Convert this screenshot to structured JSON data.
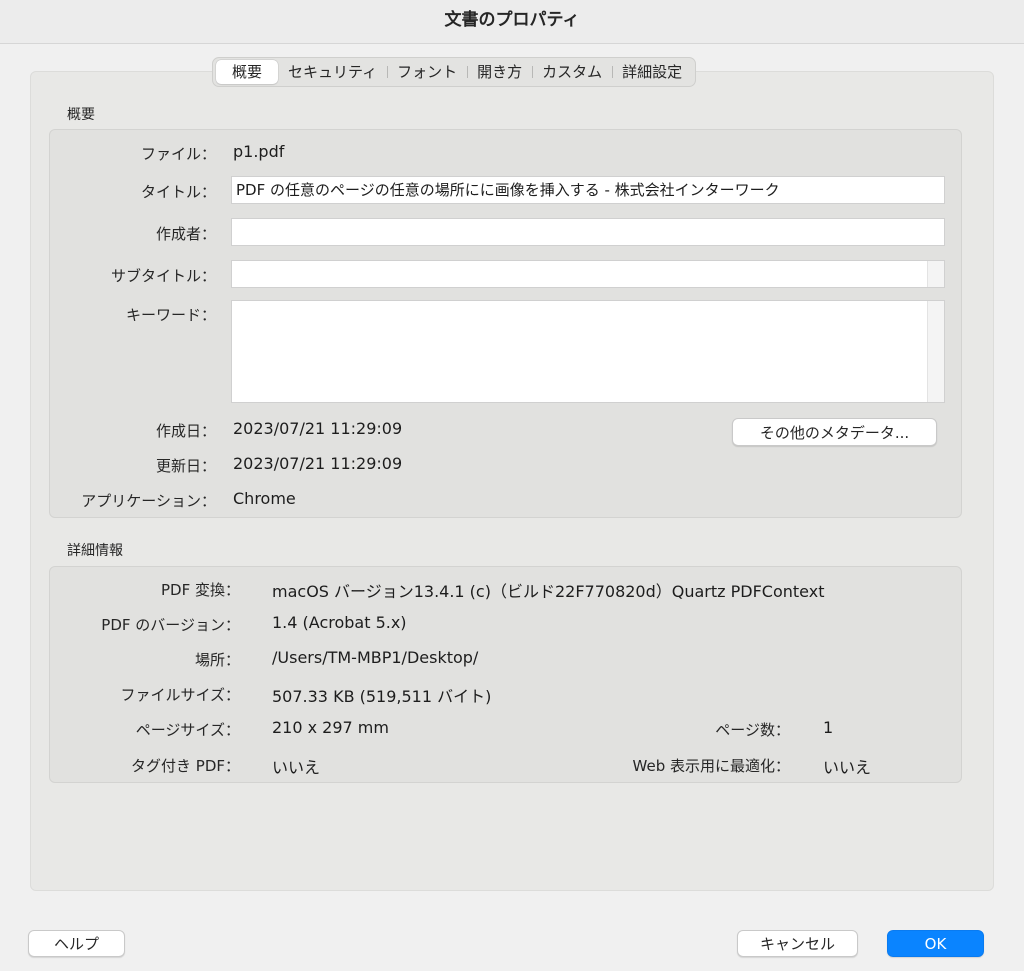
{
  "window": {
    "title": "文書のプロパティ"
  },
  "tabs": [
    {
      "label": "概要",
      "active": true
    },
    {
      "label": "セキュリティ"
    },
    {
      "label": "フォント"
    },
    {
      "label": "開き方"
    },
    {
      "label": "カスタム"
    },
    {
      "label": "詳細設定"
    }
  ],
  "overview": {
    "section_title": "概要",
    "file_label": "ファイル：",
    "file_value": "p1.pdf",
    "title_label": "タイトル：",
    "title_value": "PDF の任意のページの任意の場所にに画像を挿入する - 株式会社インターワーク",
    "author_label": "作成者：",
    "author_value": "",
    "subject_label": "サブタイトル：",
    "subject_value": "",
    "keywords_label": "キーワード：",
    "keywords_value": "",
    "created_label": "作成日：",
    "created_value": "2023/07/21 11:29:09",
    "modified_label": "更新日：",
    "modified_value": "2023/07/21 11:29:09",
    "application_label": "アプリケーション：",
    "application_value": "Chrome",
    "more_metadata_button": "その他のメタデータ..."
  },
  "details": {
    "section_title": "詳細情報",
    "producer_label": "PDF 変換：",
    "producer_value": "macOS バージョン13.4.1 (c)（ビルド22F770820d）Quartz PDFContext",
    "version_label": "PDF のバージョン：",
    "version_value": "1.4 (Acrobat 5.x)",
    "location_label": "場所：",
    "location_value": "/Users/TM-MBP1/Desktop/",
    "filesize_label": "ファイルサイズ：",
    "filesize_value": "507.33 KB (519,511 バイト)",
    "pagesize_label": "ページサイズ：",
    "pagesize_value": "210 x 297 mm",
    "pagecount_label": "ページ数：",
    "pagecount_value": "1",
    "tagged_label": "タグ付き PDF：",
    "tagged_value": "いいえ",
    "fastweb_label": "Web 表示用に最適化：",
    "fastweb_value": "いいえ"
  },
  "footer": {
    "help_button": "ヘルプ",
    "cancel_button": "キャンセル",
    "ok_button": "OK"
  },
  "colors": {
    "accent": "#0a84ff",
    "panel": "#e1e1df",
    "window": "#f0f0f0"
  }
}
